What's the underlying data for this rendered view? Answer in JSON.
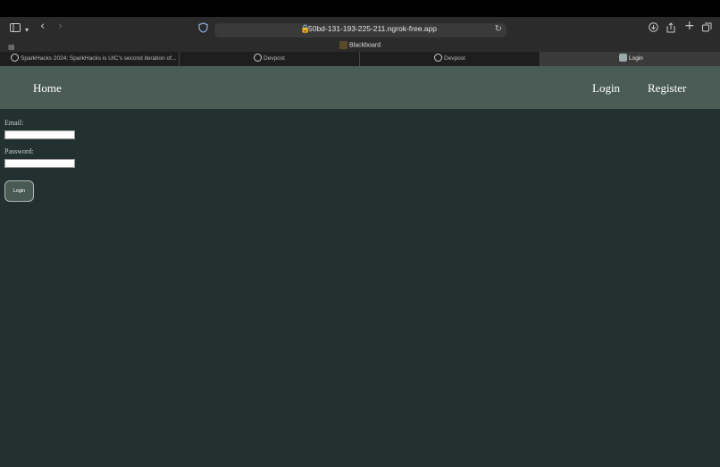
{
  "browser": {
    "url": "50bd-131-193-225-211.ngrok-free.app",
    "favorites": [
      {
        "label": "Blackboard"
      }
    ],
    "tabs": [
      {
        "label": "SparkHacks 2024: SparkHacks is UIC's second iteration of..."
      },
      {
        "label": "Devpost"
      },
      {
        "label": "Devpost"
      },
      {
        "label": "Login",
        "icon": "N",
        "active": true
      }
    ]
  },
  "nav": {
    "home": "Home",
    "login": "Login",
    "register": "Register"
  },
  "form": {
    "email_label": "Email:",
    "email_value": "",
    "password_label": "Password:",
    "password_value": "",
    "submit_label": "Login"
  },
  "colors": {
    "nav_bg": "#4a5c55",
    "page_bg": "#223130",
    "button_bg": "#495a54"
  }
}
